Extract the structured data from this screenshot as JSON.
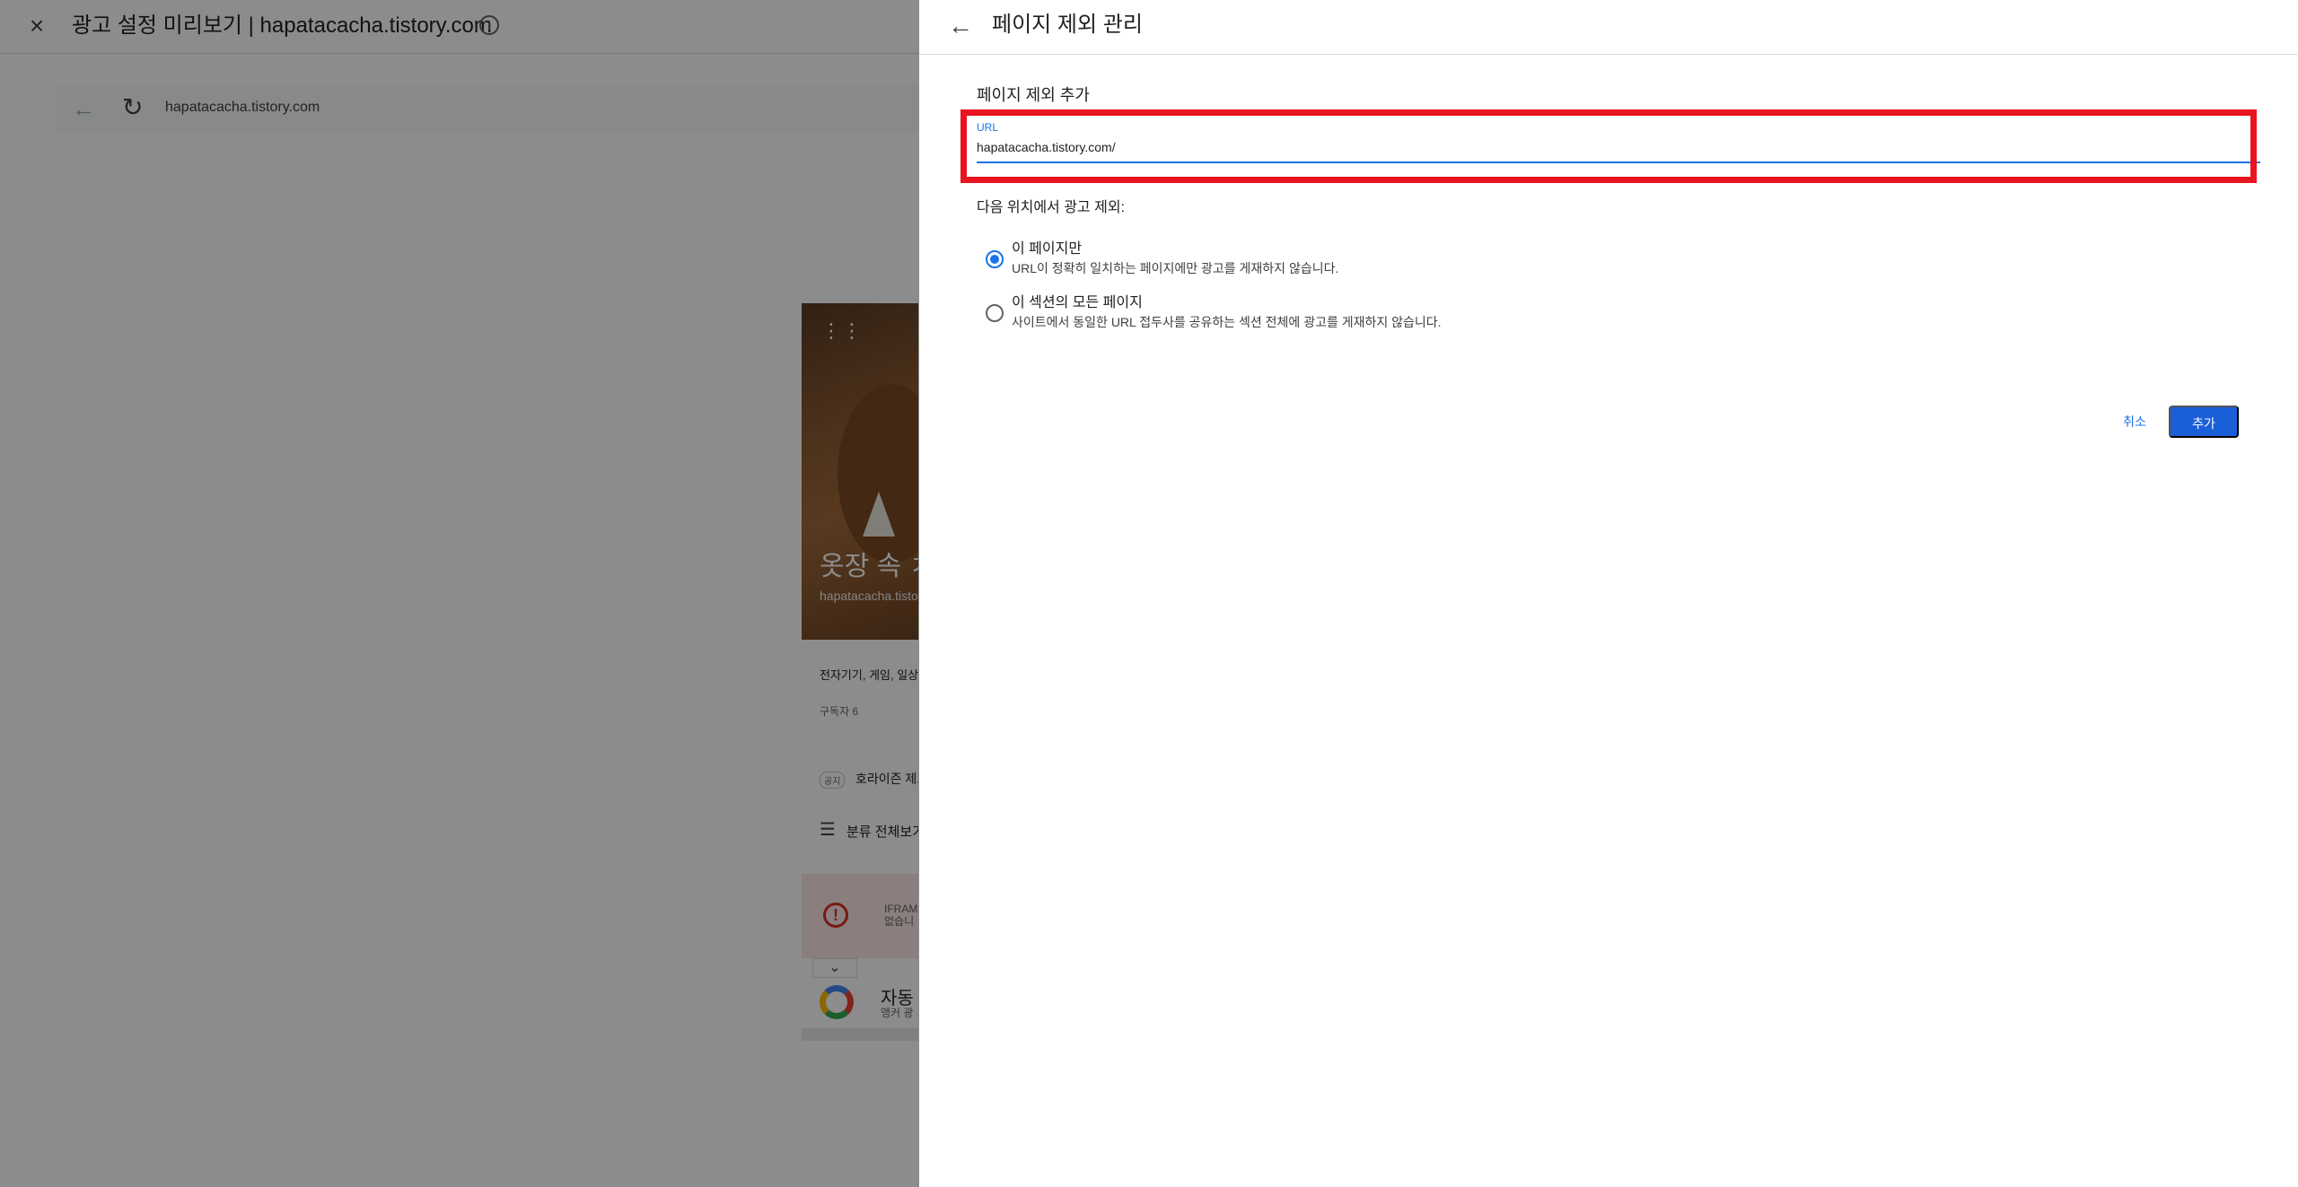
{
  "background": {
    "close_icon": "×",
    "title": "광고 설정 미리보기 | hapatacacha.tistory.com",
    "info_icon": "i",
    "nav_back_icon": "←",
    "reload_icon": "↻",
    "url": "hapatacacha.tistory.com",
    "card": {
      "menu_icon": "⋮⋮",
      "hero_title": "옷장 속 ㅈ",
      "hero_subtitle": "hapatacacha.tisto",
      "categories": "전자기기, 게임, 일상",
      "subscribers": "구독자 6",
      "notice_tag": "공지",
      "notice": "호라이즌 제로",
      "list_icon": "☰",
      "list_label": "분류 전체보기",
      "error_icon": "!",
      "error_text": "IFRAM\n없습니",
      "chevron_icon": "⌄",
      "auto_title": "자동",
      "auto_subtitle": "앵커 광"
    }
  },
  "panel": {
    "back_icon": "←",
    "title": "페이지 제외 관리",
    "section_title": "페이지 제외 추가",
    "url_field": {
      "label": "URL",
      "value": "hapatacacha.tistory.com/"
    },
    "exclude_label": "다음 위치에서 광고 제외:",
    "options": [
      {
        "title": "이 페이지만",
        "description": "URL이 정확히 일치하는 페이지에만 광고를 게재하지 않습니다.",
        "selected": true
      },
      {
        "title": "이 섹션의 모든 페이지",
        "description": "사이트에서 동일한 URL 접두사를 공유하는 섹션 전체에 광고를 게재하지 않습니다.",
        "selected": false
      }
    ],
    "cancel_label": "취소",
    "add_label": "추가"
  },
  "colors": {
    "accent": "#1a73e8",
    "primary_button": "#1a5fd8",
    "highlight_border": "#e8141f",
    "overlay": "rgba(0,0,0,0.45)"
  }
}
